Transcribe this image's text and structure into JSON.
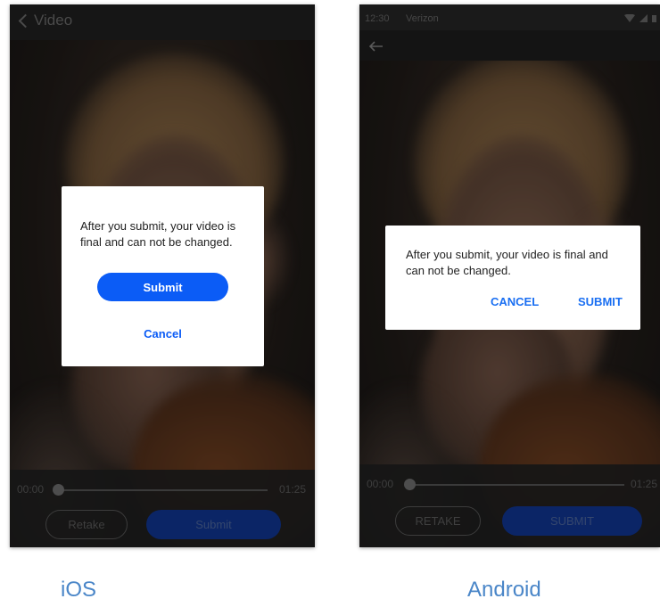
{
  "ios": {
    "nav_back_label": "Video",
    "dialog": {
      "message": "After you submit, your video is final and can not be changed.",
      "submit_label": "Submit",
      "cancel_label": "Cancel"
    },
    "player": {
      "current_time": "00:00",
      "duration": "01:25",
      "progress": 0
    },
    "retake_label": "Retake",
    "submit_label": "Submit",
    "platform_label": "iOS"
  },
  "android": {
    "status_time": "12:30",
    "carrier": "Verizon",
    "dialog": {
      "message": "After you submit, your video is final and can not be changed.",
      "cancel_label": "CANCEL",
      "submit_label": "SUBMIT"
    },
    "player": {
      "current_time": "00:00",
      "duration": "01:25",
      "progress": 0
    },
    "retake_label": "RETAKE",
    "submit_label": "SUBMIT",
    "platform_label": "Android"
  },
  "colors": {
    "accent": "#0b5cf6",
    "android_accent": "#1a6ff2",
    "label": "#4a86c8"
  },
  "icons": [
    "back-chevron-icon",
    "arrow-back-icon",
    "wifi-icon",
    "signal-icon",
    "battery-icon"
  ]
}
